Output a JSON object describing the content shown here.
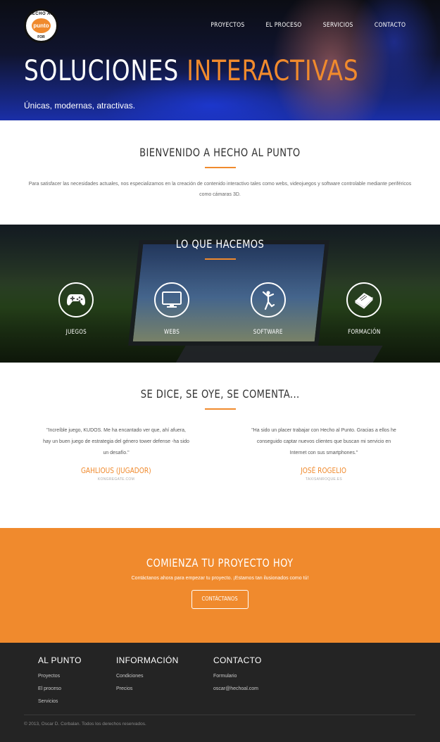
{
  "header": {
    "logo": {
      "ring_top": "HECHO AL",
      "core": "punto",
      "ring_bottom": "FOR"
    },
    "nav": [
      "PROYECTOS",
      "EL PROCESO",
      "SERVICIOS",
      "CONTACTO"
    ],
    "hero_title_main": "SOLUCIONES",
    "hero_title_accent": "INTERACTIVAS",
    "tagline": "Únicas, modernas, atractivas."
  },
  "welcome": {
    "title": "BIENVENIDO A HECHO AL PUNTO",
    "text": "Para satisfacer las necesidades actuales, nos especializamos en la creación de contenido interactivo tales como webs, videojuegos y software controlable mediante periféricos como cámaras 3D."
  },
  "services": {
    "title": "LO QUE HACEMOS",
    "items": [
      {
        "label": "JUEGOS",
        "icon": "gamepad-icon"
      },
      {
        "label": "WEBS",
        "icon": "monitor-icon"
      },
      {
        "label": "SOFTWARE",
        "icon": "dancer-icon"
      },
      {
        "label": "FORMACIÓN",
        "icon": "book-icon"
      }
    ]
  },
  "testimonials": {
    "title": "SE DICE, SE OYE, SE COMENTA...",
    "items": [
      {
        "quote": "\"Increíble juego, KUDOS. Me ha encantado ver que, ahí afuera, hay un buen juego de estrategia del género tower defense -ha sido un desafío.\"",
        "author": "GAHLIOUS (JUGADOR)",
        "source": "KONGREGATE.COM"
      },
      {
        "quote": "\"Ha sido un placer trabajar con Hecho al Punto. Gracias a ellos he conseguido captar nuevos clientes que buscan mi servicio en Internet con sus smartphones.\"",
        "author": "JOSÉ ROGELIO",
        "source": "TAXISANROQUE.ES"
      }
    ]
  },
  "cta": {
    "title": "COMIENZA TU PROYECTO HOY",
    "text": "Contáctanos ahora para empezar tu proyecto. ¡Estamos tan ilusionados como tú!",
    "button": "CONTÁCTANOS"
  },
  "footer": {
    "columns": [
      {
        "title": "AL PUNTO",
        "links": [
          "Proyectos",
          "El proceso",
          "Servicios"
        ]
      },
      {
        "title": "INFORMACIÓN",
        "links": [
          "Condiciones",
          "Precios"
        ]
      },
      {
        "title": "CONTACTO",
        "links": [
          "Formulario",
          "oscar@hechoal.com"
        ]
      }
    ],
    "copyright": "© 2013, Oscar D. Corbalan. Todos los derechos reservados."
  },
  "colors": {
    "accent": "#f08a2d",
    "footer_bg": "#242424"
  }
}
